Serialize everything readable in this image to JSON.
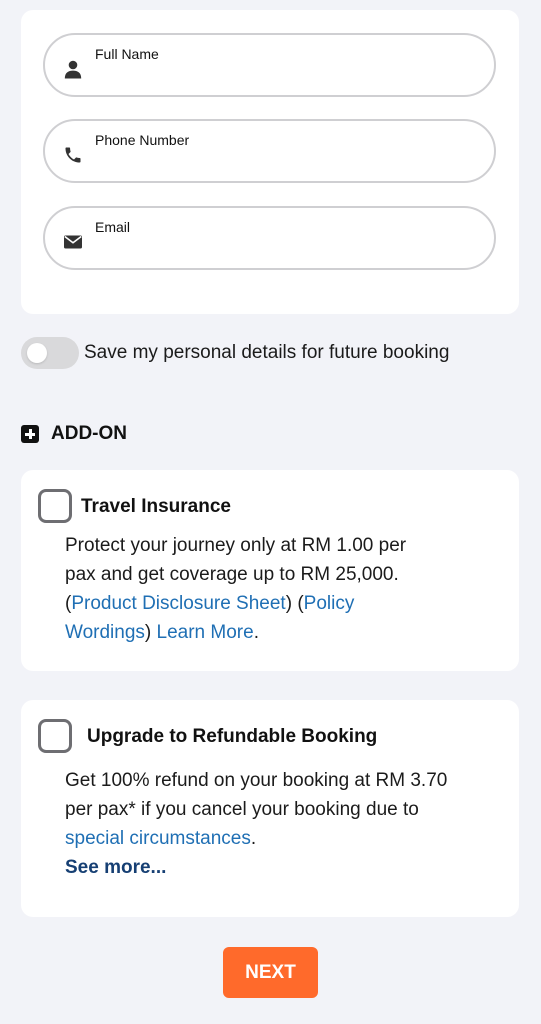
{
  "form": {
    "full_name": {
      "label": "Full Name",
      "icon": "person-icon",
      "value": ""
    },
    "phone": {
      "label": "Phone Number",
      "icon": "phone-icon",
      "value": ""
    },
    "email": {
      "label": "Email",
      "icon": "envelope-icon",
      "value": ""
    }
  },
  "save_details": {
    "label": "Save my personal details for future booking",
    "enabled": false
  },
  "addon": {
    "heading": "ADD-ON",
    "insurance": {
      "title": "Travel Insurance",
      "line1": "Protect your journey only at RM 1.00 per",
      "line2": "pax and get coverage up to RM 25,000.",
      "open_paren": "(",
      "pds_link": "Product Disclosure Sheet",
      "close_open_paren": ") (",
      "policy_link_1": "Policy",
      "policy_link_2": "Wordings",
      "close_paren": ")",
      "learn_more": "Learn More",
      "period": "."
    },
    "refundable": {
      "title": "Upgrade to Refundable Booking",
      "line1": "Get 100% refund on your booking at RM 3.70",
      "line2": "per pax* if you cancel your booking due to",
      "special_link": "special circumstances",
      "period": ".",
      "see_more": "See more..."
    }
  },
  "next_label": "NEXT",
  "colors": {
    "accent": "#ff6a2b",
    "link": "#1f6fb4",
    "see_more": "#163f73",
    "background": "#f2f3f8"
  }
}
